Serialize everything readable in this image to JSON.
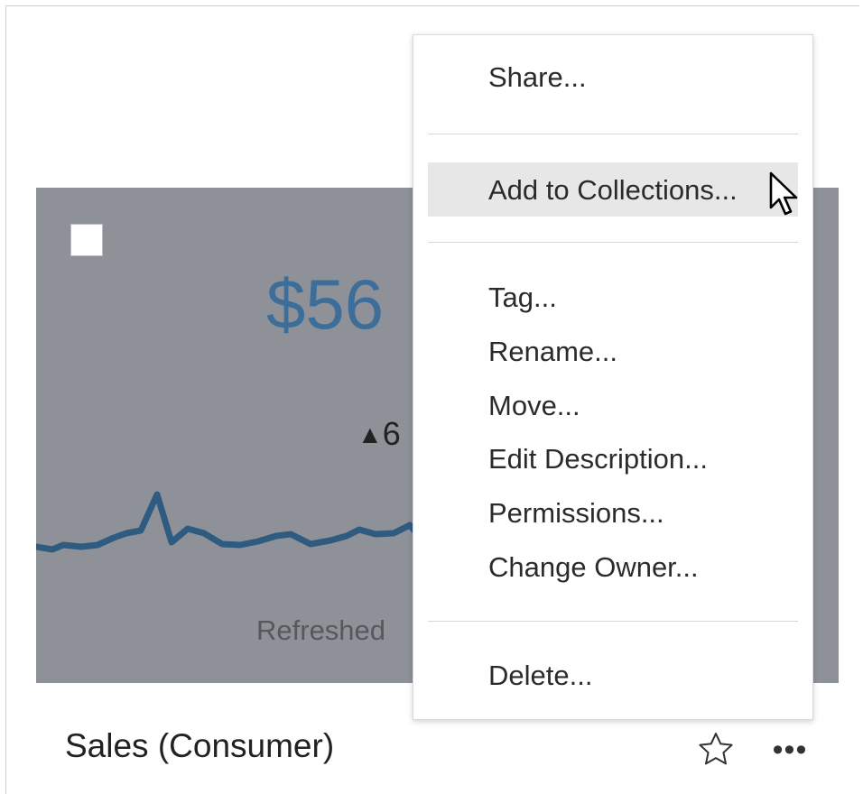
{
  "card": {
    "title": "Sales (Consumer)",
    "big_value": "$56",
    "delta_triangle": "▲",
    "delta_value": "6",
    "refreshed_text": "Refreshed",
    "favorite_icon": "star-outline-icon",
    "more_icon": "more-horizontal-icon",
    "more_label": "•••",
    "sparkline_color": "#2f5b80",
    "background_color": "#8e9298",
    "value_color": "#3d6d99"
  },
  "menu": {
    "share": "Share...",
    "add_to_collections": "Add to Collections...",
    "tag": "Tag...",
    "rename": "Rename...",
    "move": "Move...",
    "edit_description": "Edit Description...",
    "permissions": "Permissions...",
    "change_owner": "Change Owner...",
    "delete": "Delete..."
  }
}
